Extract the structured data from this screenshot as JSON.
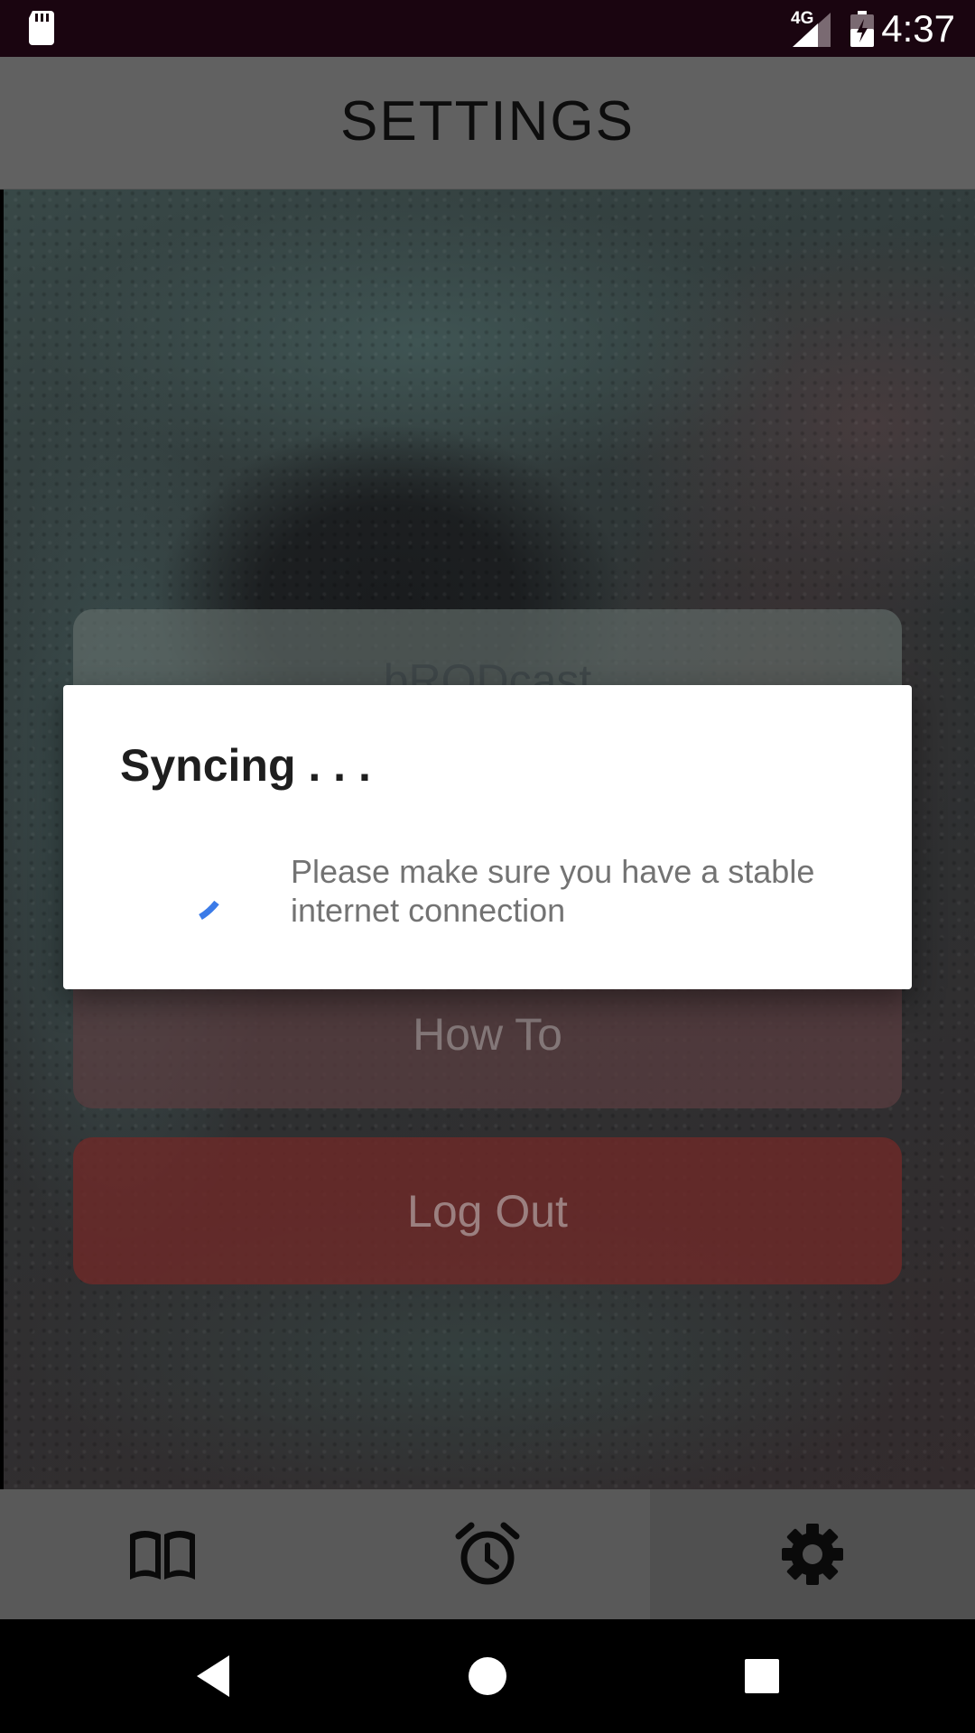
{
  "status_bar": {
    "time": "4:37",
    "network_label": "4G",
    "icons": [
      "sd-card-icon",
      "signal-icon",
      "battery-charging-icon"
    ]
  },
  "header": {
    "title": "SETTINGS"
  },
  "menu": {
    "broadcast_label": "bRODcast",
    "howto_label": "How To",
    "logout_label": "Log Out"
  },
  "bottom_nav": {
    "items": [
      {
        "icon": "book-icon",
        "active": false
      },
      {
        "icon": "alarm-clock-icon",
        "active": false
      },
      {
        "icon": "gear-icon",
        "active": true
      }
    ]
  },
  "dialog": {
    "title": "Syncing . . .",
    "message": "Please make sure you have a stable internet connection",
    "spinner_color": "#3b7be8"
  },
  "system_nav": {
    "icons": [
      "back-icon",
      "home-icon",
      "recents-icon"
    ]
  }
}
